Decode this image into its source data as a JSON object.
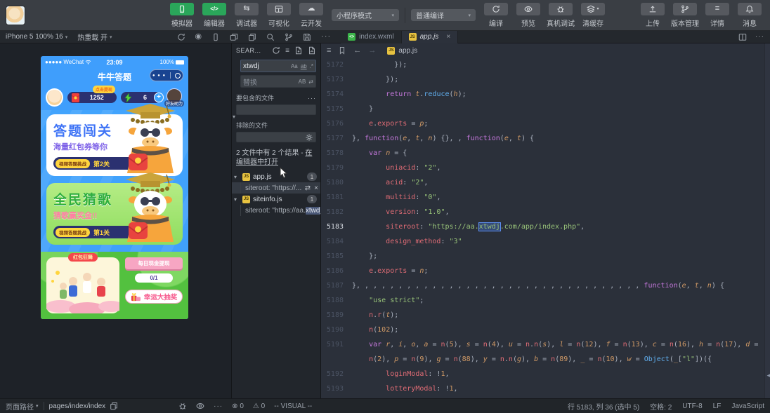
{
  "colors": {
    "accent_green": "#2aa65a",
    "phone_blue": "#3f9efc",
    "js_yellow": "#e8c341",
    "editor_bg": "#2b303a",
    "selection_blue": "#5c8ef0"
  },
  "toolbar": {
    "mode_buttons": [
      {
        "label": "模拟器",
        "icon": "phone",
        "active": true
      },
      {
        "label": "编辑器",
        "icon": "code",
        "active": true
      },
      {
        "label": "调试器",
        "icon": "swap",
        "active": false
      },
      {
        "label": "可视化",
        "icon": "layout",
        "active": false
      },
      {
        "label": "云开发",
        "icon": "cloud",
        "active": false
      }
    ],
    "mode_select": "小程序模式",
    "compile_select": "普通编译",
    "compile_actions": [
      {
        "label": "编译",
        "icon": "refresh"
      },
      {
        "label": "预览",
        "icon": "eye"
      },
      {
        "label": "真机调试",
        "icon": "bug"
      },
      {
        "label": "清缓存",
        "icon": "layers",
        "caret": true
      }
    ],
    "right_buttons": [
      {
        "label": "上传",
        "icon": "upload"
      },
      {
        "label": "版本管理",
        "icon": "branch"
      },
      {
        "label": "详情",
        "icon": "list"
      },
      {
        "label": "消息",
        "icon": "bell"
      }
    ]
  },
  "device_bar": {
    "device": "iPhone 5 100% 16",
    "hot_reload": "热重载 开",
    "icons": [
      "refresh",
      "record",
      "device",
      "windows",
      "copy",
      "search",
      "branch",
      "save",
      "more"
    ],
    "tabs": [
      {
        "label": "index.wxml",
        "kind": "wxml",
        "active": false,
        "closable": false
      },
      {
        "label": "app.js",
        "kind": "js",
        "active": true,
        "closable": true
      }
    ]
  },
  "search_panel": {
    "title": "SEAR...",
    "query": "xtwdj",
    "case_icon": "Aa",
    "word_icon": "ab",
    "regex_icon": ".*",
    "replace_placeholder": "替换",
    "preserve_icon": "AB",
    "include_label": "要包含的文件",
    "exclude_label": "排除的文件",
    "summary": "2 文件中有 2 个结果 - ",
    "summary_link": "在编辑器中打开",
    "results": [
      {
        "file": "app.js",
        "count": "1",
        "match_prefix": "siteroot: \"https://...",
        "match_hl": "",
        "match_suffix": "",
        "hover": true
      },
      {
        "file": "siteinfo.js",
        "count": "1",
        "match_prefix": "siteroot: \"https://aa.",
        "match_hl": "xtwdj",
        "match_suffix": "....",
        "hover": false
      }
    ]
  },
  "editor": {
    "breadcrumb_file": "app.js",
    "lines": [
      {
        "n": "5172",
        "t": [
          [
            "pl",
            "          });"
          ]
        ]
      },
      {
        "n": "5173",
        "t": [
          [
            "pl",
            "        });"
          ]
        ]
      },
      {
        "n": "5174",
        "t": [
          [
            "pl",
            "        "
          ],
          [
            "kw",
            "return"
          ],
          [
            "pl",
            " "
          ],
          [
            "vr",
            "t"
          ],
          [
            "pl",
            "."
          ],
          [
            "fn",
            "reduce"
          ],
          [
            "pl",
            "("
          ],
          [
            "vr",
            "h"
          ],
          [
            "pl",
            ");"
          ]
        ]
      },
      {
        "n": "5175",
        "t": [
          [
            "pl",
            "    }"
          ]
        ]
      },
      {
        "n": "5176",
        "t": [
          [
            "pl",
            "    "
          ],
          [
            "pr",
            "e"
          ],
          [
            "pl",
            "."
          ],
          [
            "pr",
            "exports"
          ],
          [
            "pl",
            " = "
          ],
          [
            "vr",
            "p"
          ],
          [
            "pl",
            ";"
          ]
        ]
      },
      {
        "n": "5177",
        "t": [
          [
            "pl",
            "}, "
          ],
          [
            "kw",
            "function"
          ],
          [
            "pl",
            "("
          ],
          [
            "vr",
            "e"
          ],
          [
            "pl",
            ", "
          ],
          [
            "vr",
            "t"
          ],
          [
            "pl",
            ", "
          ],
          [
            "vr",
            "n"
          ],
          [
            "pl",
            ") {}, , "
          ],
          [
            "kw",
            "function"
          ],
          [
            "pl",
            "("
          ],
          [
            "vr",
            "e"
          ],
          [
            "pl",
            ", "
          ],
          [
            "vr",
            "t"
          ],
          [
            "pl",
            ") {"
          ]
        ]
      },
      {
        "n": "5178",
        "t": [
          [
            "pl",
            "    "
          ],
          [
            "kw",
            "var"
          ],
          [
            "pl",
            " "
          ],
          [
            "vr",
            "n"
          ],
          [
            "pl",
            " = {"
          ]
        ]
      },
      {
        "n": "5179",
        "t": [
          [
            "pl",
            "        "
          ],
          [
            "pr",
            "uniacid"
          ],
          [
            "pl",
            ": "
          ],
          [
            "st",
            "\"2\""
          ],
          [
            "pl",
            ","
          ]
        ]
      },
      {
        "n": "5180",
        "t": [
          [
            "pl",
            "        "
          ],
          [
            "pr",
            "acid"
          ],
          [
            "pl",
            ": "
          ],
          [
            "st",
            "\"2\""
          ],
          [
            "pl",
            ","
          ]
        ]
      },
      {
        "n": "5181",
        "t": [
          [
            "pl",
            "        "
          ],
          [
            "pr",
            "multiid"
          ],
          [
            "pl",
            ": "
          ],
          [
            "st",
            "\"0\""
          ],
          [
            "pl",
            ","
          ]
        ]
      },
      {
        "n": "5182",
        "t": [
          [
            "pl",
            "        "
          ],
          [
            "pr",
            "version"
          ],
          [
            "pl",
            ": "
          ],
          [
            "st",
            "\"1.0\""
          ],
          [
            "pl",
            ","
          ]
        ]
      },
      {
        "n": "5183",
        "cur": true,
        "t": [
          [
            "pl",
            "        "
          ],
          [
            "pr",
            "siteroot"
          ],
          [
            "pl",
            ": "
          ],
          [
            "st",
            "\"https://aa."
          ],
          [
            "sel",
            "xtwdj"
          ],
          [
            "st",
            ".com/app/index.php\""
          ],
          [
            "pl",
            ","
          ]
        ]
      },
      {
        "n": "5184",
        "t": [
          [
            "pl",
            "        "
          ],
          [
            "pr",
            "design_method"
          ],
          [
            "pl",
            ": "
          ],
          [
            "st",
            "\"3\""
          ]
        ]
      },
      {
        "n": "5185",
        "t": [
          [
            "pl",
            "    };"
          ]
        ]
      },
      {
        "n": "5186",
        "t": [
          [
            "pl",
            "    "
          ],
          [
            "pr",
            "e"
          ],
          [
            "pl",
            "."
          ],
          [
            "pr",
            "exports"
          ],
          [
            "pl",
            " = "
          ],
          [
            "vr",
            "n"
          ],
          [
            "pl",
            ";"
          ]
        ]
      },
      {
        "n": "5187",
        "t": [
          [
            "pl",
            "}, , , , , , , , , , , , , , , , , , , , , , , , , , , , , , , , , , "
          ],
          [
            "kw",
            "function"
          ],
          [
            "pl",
            "("
          ],
          [
            "vr",
            "e"
          ],
          [
            "pl",
            ", "
          ],
          [
            "vr",
            "t"
          ],
          [
            "pl",
            ", "
          ],
          [
            "vr",
            "n"
          ],
          [
            "pl",
            ") {"
          ]
        ]
      },
      {
        "n": "5188",
        "t": [
          [
            "pl",
            "    "
          ],
          [
            "st",
            "\"use strict\""
          ],
          [
            "pl",
            ";"
          ]
        ]
      },
      {
        "n": "5189",
        "t": [
          [
            "pl",
            "    "
          ],
          [
            "pr",
            "n"
          ],
          [
            "pl",
            "."
          ],
          [
            "pr",
            "r"
          ],
          [
            "pl",
            "("
          ],
          [
            "vr",
            "t"
          ],
          [
            "pl",
            ");"
          ]
        ]
      },
      {
        "n": "5190",
        "t": [
          [
            "pl",
            "    "
          ],
          [
            "pr",
            "n"
          ],
          [
            "pl",
            "("
          ],
          [
            "nm",
            "102"
          ],
          [
            "pl",
            ");"
          ]
        ]
      },
      {
        "n": "5191",
        "t": [
          [
            "pl",
            "    "
          ],
          [
            "kw",
            "var"
          ],
          [
            "pl",
            " "
          ],
          [
            "vr",
            "r"
          ],
          [
            "pl",
            ", "
          ],
          [
            "vr",
            "i"
          ],
          [
            "pl",
            ", "
          ],
          [
            "vr",
            "o"
          ],
          [
            "pl",
            ", "
          ],
          [
            "vr",
            "a"
          ],
          [
            "pl",
            " = "
          ],
          [
            "pr",
            "n"
          ],
          [
            "pl",
            "("
          ],
          [
            "nm",
            "5"
          ],
          [
            "pl",
            "), "
          ],
          [
            "vr",
            "s"
          ],
          [
            "pl",
            " = "
          ],
          [
            "pr",
            "n"
          ],
          [
            "pl",
            "("
          ],
          [
            "nm",
            "4"
          ],
          [
            "pl",
            "), "
          ],
          [
            "vr",
            "u"
          ],
          [
            "pl",
            " = "
          ],
          [
            "pr",
            "n"
          ],
          [
            "pl",
            "."
          ],
          [
            "pr",
            "n"
          ],
          [
            "pl",
            "("
          ],
          [
            "vr",
            "s"
          ],
          [
            "pl",
            "), "
          ],
          [
            "vr",
            "l"
          ],
          [
            "pl",
            " = "
          ],
          [
            "pr",
            "n"
          ],
          [
            "pl",
            "("
          ],
          [
            "nm",
            "12"
          ],
          [
            "pl",
            "), "
          ],
          [
            "vr",
            "f"
          ],
          [
            "pl",
            " = "
          ],
          [
            "pr",
            "n"
          ],
          [
            "pl",
            "("
          ],
          [
            "nm",
            "13"
          ],
          [
            "pl",
            "), "
          ],
          [
            "vr",
            "c"
          ],
          [
            "pl",
            " = "
          ],
          [
            "pr",
            "n"
          ],
          [
            "pl",
            "("
          ],
          [
            "nm",
            "16"
          ],
          [
            "pl",
            "), "
          ],
          [
            "vr",
            "h"
          ],
          [
            "pl",
            " = "
          ],
          [
            "pr",
            "n"
          ],
          [
            "pl",
            "("
          ],
          [
            "nm",
            "17"
          ],
          [
            "pl",
            "), "
          ],
          [
            "vr",
            "d"
          ],
          [
            "pl",
            " ="
          ]
        ]
      },
      {
        "n": "",
        "t": [
          [
            "pl",
            "    "
          ],
          [
            "pr",
            "n"
          ],
          [
            "pl",
            "("
          ],
          [
            "nm",
            "2"
          ],
          [
            "pl",
            "), "
          ],
          [
            "vr",
            "p"
          ],
          [
            "pl",
            " = "
          ],
          [
            "pr",
            "n"
          ],
          [
            "pl",
            "("
          ],
          [
            "nm",
            "9"
          ],
          [
            "pl",
            "), "
          ],
          [
            "vr",
            "g"
          ],
          [
            "pl",
            " = "
          ],
          [
            "pr",
            "n"
          ],
          [
            "pl",
            "("
          ],
          [
            "nm",
            "88"
          ],
          [
            "pl",
            "), "
          ],
          [
            "vr",
            "y"
          ],
          [
            "pl",
            " = "
          ],
          [
            "pr",
            "n"
          ],
          [
            "pl",
            "."
          ],
          [
            "pr",
            "n"
          ],
          [
            "pl",
            "("
          ],
          [
            "vr",
            "g"
          ],
          [
            "pl",
            "), "
          ],
          [
            "vr",
            "b"
          ],
          [
            "pl",
            " = "
          ],
          [
            "pr",
            "n"
          ],
          [
            "pl",
            "("
          ],
          [
            "nm",
            "89"
          ],
          [
            "pl",
            "), "
          ],
          [
            "vr",
            "_"
          ],
          [
            "pl",
            " = "
          ],
          [
            "pr",
            "n"
          ],
          [
            "pl",
            "("
          ],
          [
            "nm",
            "10"
          ],
          [
            "pl",
            "), "
          ],
          [
            "vr",
            "w"
          ],
          [
            "pl",
            " = "
          ],
          [
            "fn",
            "Object"
          ],
          [
            "pl",
            "("
          ],
          [
            "vr",
            "_"
          ],
          [
            "pl",
            "["
          ],
          [
            "st",
            "\"l\""
          ],
          [
            "pl",
            "])({"
          ]
        ]
      },
      {
        "n": "5192",
        "t": [
          [
            "pl",
            "        "
          ],
          [
            "pr",
            "loginModal"
          ],
          [
            "pl",
            ": !"
          ],
          [
            "nm",
            "1"
          ],
          [
            "pl",
            ","
          ]
        ]
      },
      {
        "n": "5193",
        "t": [
          [
            "pl",
            "        "
          ],
          [
            "pr",
            "lotteryModal"
          ],
          [
            "pl",
            ": !"
          ],
          [
            "nm",
            "1"
          ],
          [
            "pl",
            ","
          ]
        ]
      }
    ]
  },
  "simulator": {
    "status_bar": {
      "carrier": "●●●●● WeChat",
      "time": "23:09",
      "battery": "100%"
    },
    "nav_title": "牛牛答题",
    "capsule_dots": "● ● ●",
    "header": {
      "coins": "1252",
      "withdraw_tip": "点击提现",
      "energy": "6",
      "plus": "+",
      "friend_help": "好友助力"
    },
    "card1": {
      "title": "答题闯关",
      "subtitle": "海量红包券等你",
      "tag": "视频答题挑战",
      "level": "第2关"
    },
    "card2": {
      "title": "全民猜歌",
      "subtitle": "猜歌赢奖金!!",
      "tag": "视频答题挑战",
      "level": "第1关"
    },
    "bottom": {
      "dance": "红包狂舞",
      "withdraw": "每日现金提现",
      "progress": "0/1",
      "lottery": "幸运大抽奖"
    }
  },
  "statusbar": {
    "left_label": "页面路径",
    "path": "pages/index/index",
    "errors": "0",
    "warnings": "0",
    "mode": "-- VISUAL --",
    "cursor": "行 5183, 列 36 (选中 5)",
    "spaces": "空格: 2",
    "encoding": "UTF-8",
    "eol": "LF",
    "language": "JavaScript"
  }
}
